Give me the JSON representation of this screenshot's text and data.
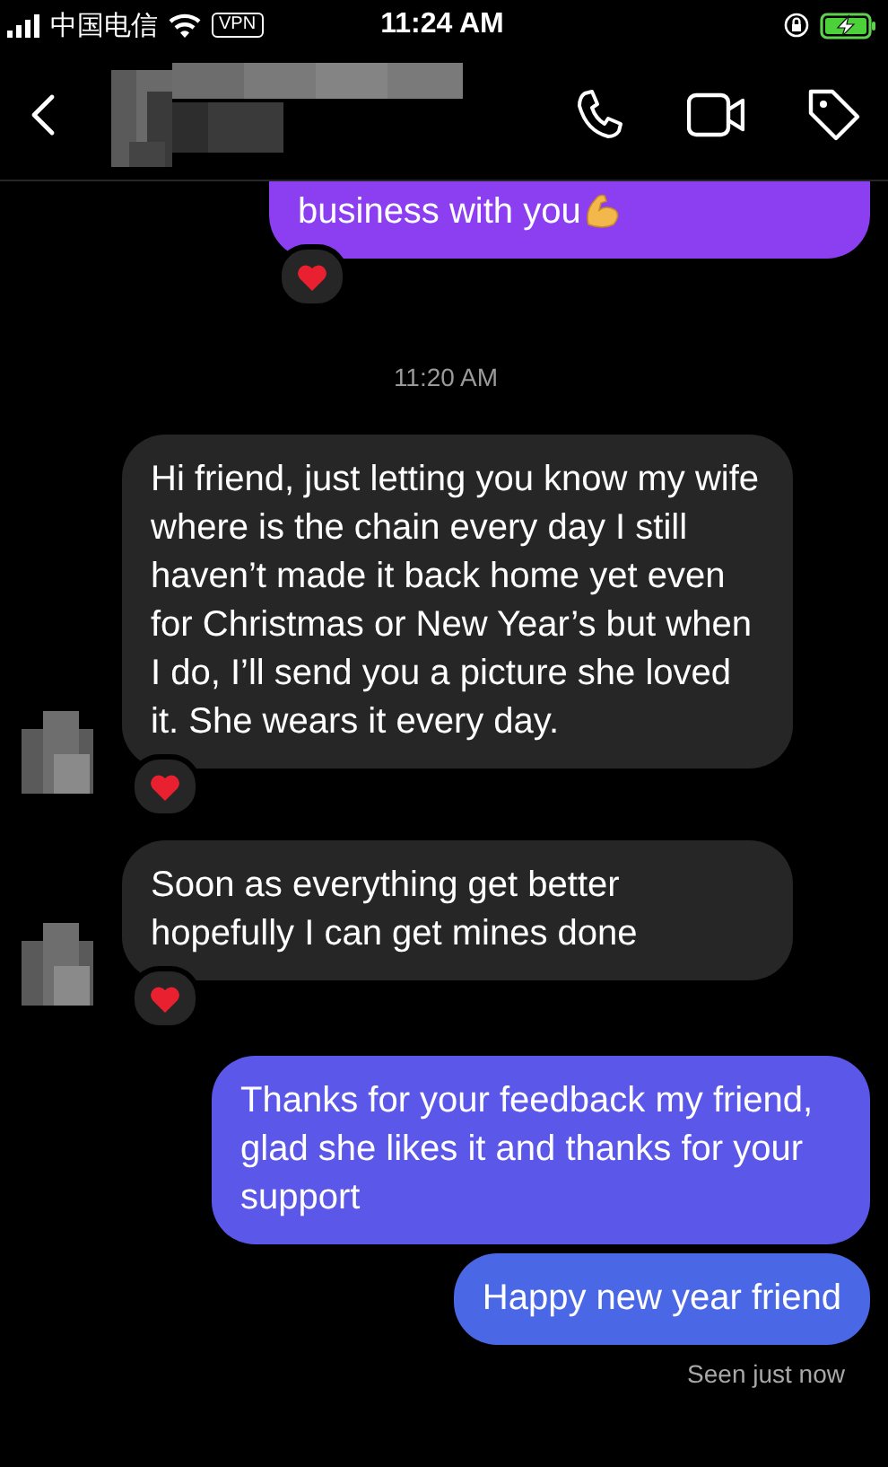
{
  "status_bar": {
    "carrier": "中国电信",
    "vpn": "VPN",
    "time": "11:24 AM",
    "charging": true
  },
  "header": {
    "name_redacted": true
  },
  "messages": [
    {
      "kind": "outgoing",
      "text": "business with you",
      "emoji_icon": true,
      "color": "#8b3ff0",
      "reaction": true
    },
    {
      "kind": "timestamp",
      "text": "11:20 AM"
    },
    {
      "kind": "incoming",
      "text": "Hi friend, just letting you know my wife where is the chain every day I still haven’t made it back home yet even for Christmas or New Year’s but when I do, I’ll send you a picture she loved it. She wears it every day.",
      "avatar": true,
      "reaction": true
    },
    {
      "kind": "incoming",
      "text": "Soon as everything get better hopefully I can get mines done",
      "avatar": true,
      "reaction": true
    },
    {
      "kind": "outgoing",
      "text": "Thanks for your feedback my friend, glad she likes it and thanks for your support",
      "color": "#5b57e8",
      "reaction": false
    },
    {
      "kind": "outgoing",
      "text": "Happy new year friend",
      "color": "#4a67e6",
      "reaction": false
    },
    {
      "kind": "seen",
      "text": "Seen just now"
    }
  ]
}
